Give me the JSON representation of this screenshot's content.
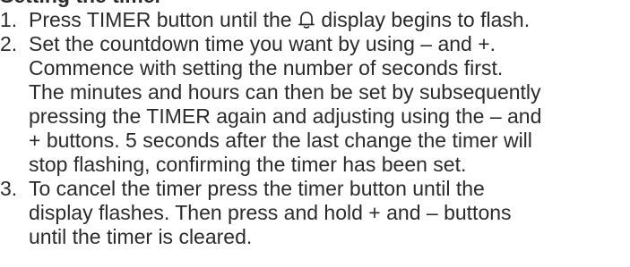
{
  "heading": "Setting the timer",
  "icons": {
    "bell": "bell-icon"
  },
  "steps": [
    {
      "number": "1.",
      "lines": [
        {
          "before_icon": "Press TIMER button until the ",
          "icon": "bell-icon",
          "after_icon": " display begins to flash."
        }
      ]
    },
    {
      "number": "2.",
      "lines": [
        "Set the countdown time you want by using – and +.",
        "Commence with setting the number of seconds first.",
        "The minutes and hours can then be set by subsequently",
        "pressing the TIMER again and adjusting using the – and",
        "+ buttons. 5 seconds after the last change the timer will",
        "stop flashing, confirming the timer has been set."
      ]
    },
    {
      "number": "3.",
      "lines": [
        "To cancel the timer press the timer button until the",
        "display flashes. Then press and hold + and – buttons",
        "until the timer is cleared."
      ]
    }
  ]
}
